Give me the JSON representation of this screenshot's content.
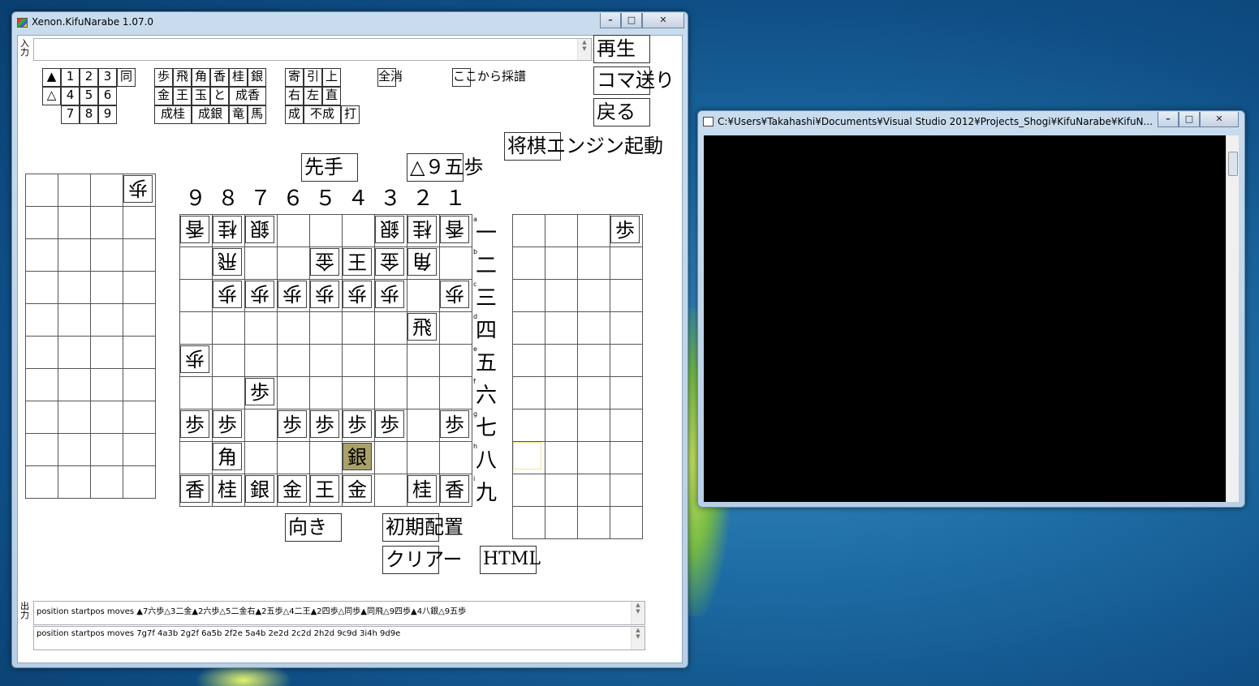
{
  "main_window": {
    "title": "Xenon.KifuNarabe 1.07.0",
    "minimize": "–",
    "maximize": "□",
    "close": "✕",
    "input_label": "入\n力",
    "output_label": "出\n力",
    "output_line1": "position startpos moves ▲7六歩△3二金▲2六歩△5二金右▲2五歩△4二王▲2四歩△同歩▲同飛△9四歩▲4八銀△9五歩",
    "output_line2": "position startpos moves 7g7f 4a3b 2g2f 6a5b 2f2e 5a4b 2e2d 2c2d 2h2d 9c9d 3i4h 9d9e"
  },
  "input_keys": {
    "row1": [
      "▲",
      "1",
      "2",
      "3",
      "同"
    ],
    "row2": [
      "△",
      "4",
      "5",
      "6"
    ],
    "row3": [
      "7",
      "8",
      "9"
    ],
    "pieces_row1": [
      "歩",
      "飛",
      "角",
      "香",
      "桂",
      "銀"
    ],
    "pieces_row2": [
      "金",
      "王",
      "玉",
      "と",
      "成香"
    ],
    "pieces_row3": [
      "成桂",
      "成銀",
      "竜",
      "馬"
    ],
    "moves_row1": [
      "寄",
      "引",
      "上"
    ],
    "moves_row2": [
      "右",
      "左",
      "直"
    ],
    "moves_row3": [
      "成",
      "不成",
      "打"
    ],
    "clear_all": "全消",
    "record_from_here": "ここから採譜"
  },
  "buttons": {
    "play": "再生",
    "step": "コマ送り",
    "back": "戻る",
    "start_engine": "将棋エンジン起動",
    "sente": "先手",
    "last_move": "△９五歩",
    "direction": "向き",
    "initial_setup": "初期配置",
    "clear": "クリアー",
    "html": "HTML"
  },
  "board": {
    "columns": [
      "９",
      "８",
      "７",
      "６",
      "５",
      "４",
      "３",
      "２",
      "１"
    ],
    "rows": [
      "一",
      "二",
      "三",
      "四",
      "五",
      "六",
      "七",
      "八",
      "九"
    ],
    "row_letters": [
      "a",
      "b",
      "c",
      "d",
      "e",
      "f",
      "g",
      "h",
      "i"
    ],
    "pieces": [
      {
        "r": 0,
        "c": 0,
        "k": "香",
        "gote": true
      },
      {
        "r": 0,
        "c": 1,
        "k": "桂",
        "gote": true
      },
      {
        "r": 0,
        "c": 2,
        "k": "銀",
        "gote": true
      },
      {
        "r": 0,
        "c": 6,
        "k": "銀",
        "gote": true
      },
      {
        "r": 0,
        "c": 7,
        "k": "桂",
        "gote": true
      },
      {
        "r": 0,
        "c": 8,
        "k": "香",
        "gote": true
      },
      {
        "r": 1,
        "c": 1,
        "k": "飛",
        "gote": true
      },
      {
        "r": 1,
        "c": 4,
        "k": "金",
        "gote": true
      },
      {
        "r": 1,
        "c": 5,
        "k": "王",
        "gote": false
      },
      {
        "r": 1,
        "c": 6,
        "k": "金",
        "gote": true
      },
      {
        "r": 1,
        "c": 7,
        "k": "角",
        "gote": true
      },
      {
        "r": 2,
        "c": 1,
        "k": "歩",
        "gote": true
      },
      {
        "r": 2,
        "c": 2,
        "k": "歩",
        "gote": true
      },
      {
        "r": 2,
        "c": 3,
        "k": "歩",
        "gote": true
      },
      {
        "r": 2,
        "c": 4,
        "k": "歩",
        "gote": true
      },
      {
        "r": 2,
        "c": 5,
        "k": "歩",
        "gote": true
      },
      {
        "r": 2,
        "c": 6,
        "k": "歩",
        "gote": true
      },
      {
        "r": 2,
        "c": 8,
        "k": "歩",
        "gote": true
      },
      {
        "r": 3,
        "c": 7,
        "k": "飛",
        "gote": false
      },
      {
        "r": 4,
        "c": 0,
        "k": "歩",
        "gote": true
      },
      {
        "r": 5,
        "c": 2,
        "k": "歩",
        "gote": false
      },
      {
        "r": 6,
        "c": 0,
        "k": "歩",
        "gote": false
      },
      {
        "r": 6,
        "c": 1,
        "k": "歩",
        "gote": false
      },
      {
        "r": 6,
        "c": 3,
        "k": "歩",
        "gote": false
      },
      {
        "r": 6,
        "c": 4,
        "k": "歩",
        "gote": false
      },
      {
        "r": 6,
        "c": 5,
        "k": "歩",
        "gote": false
      },
      {
        "r": 6,
        "c": 6,
        "k": "歩",
        "gote": false
      },
      {
        "r": 6,
        "c": 8,
        "k": "歩",
        "gote": false
      },
      {
        "r": 7,
        "c": 1,
        "k": "角",
        "gote": false
      },
      {
        "r": 7,
        "c": 5,
        "k": "銀",
        "gote": false,
        "highlight": true
      },
      {
        "r": 8,
        "c": 0,
        "k": "香",
        "gote": false
      },
      {
        "r": 8,
        "c": 1,
        "k": "桂",
        "gote": false
      },
      {
        "r": 8,
        "c": 2,
        "k": "銀",
        "gote": false
      },
      {
        "r": 8,
        "c": 3,
        "k": "金",
        "gote": false
      },
      {
        "r": 8,
        "c": 4,
        "k": "王",
        "gote": false
      },
      {
        "r": 8,
        "c": 5,
        "k": "金",
        "gote": false
      },
      {
        "r": 8,
        "c": 7,
        "k": "桂",
        "gote": false
      },
      {
        "r": 8,
        "c": 8,
        "k": "香",
        "gote": false
      }
    ]
  },
  "gote_hand": {
    "pieces": [
      {
        "r": 0,
        "c": 3,
        "k": "歩",
        "gote": true
      }
    ]
  },
  "sente_hand": {
    "pieces": [
      {
        "r": 0,
        "c": 3,
        "k": "歩",
        "gote": false
      }
    ],
    "cursor_cell": {
      "r": 7,
      "c": 0
    }
  },
  "console_window": {
    "title": "C:¥Users¥Takahashi¥Documents¥Visual Studio 2012¥Projects_Shogi¥KifuNarabe¥KifuN...",
    "minimize": "–",
    "maximize": "□",
    "close": "✕"
  },
  "colors": {
    "highlight": "#a9a169",
    "cursor": "#f0e68c",
    "console_bg": "#000000"
  }
}
